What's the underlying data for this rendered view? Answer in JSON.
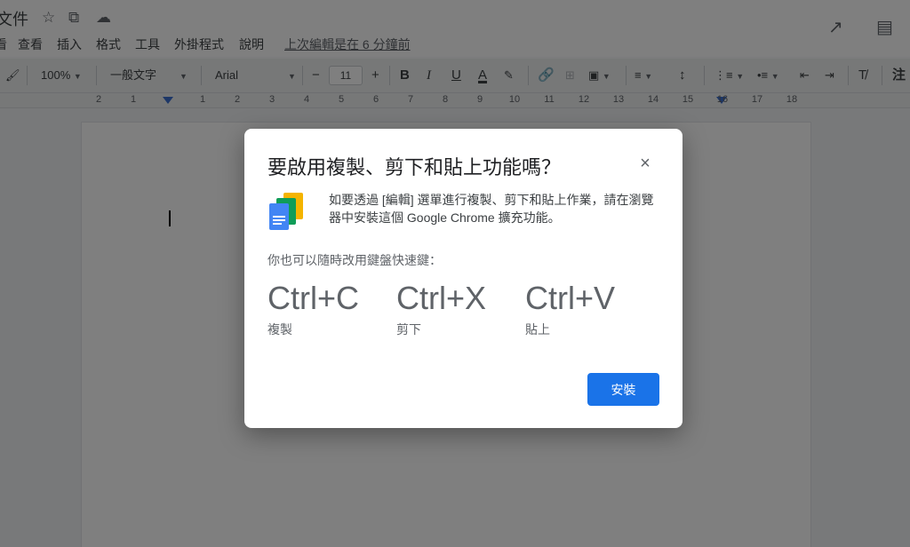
{
  "doc": {
    "title": "文件",
    "last_edit": "上次編輯是在 6 分鐘前"
  },
  "menu": [
    {
      "label": "看"
    },
    {
      "label": "查看"
    },
    {
      "label": "插入"
    },
    {
      "label": "格式"
    },
    {
      "label": "工具"
    },
    {
      "label": "外掛程式"
    },
    {
      "label": "說明"
    }
  ],
  "toolbar": {
    "zoom": "100%",
    "style": "一般文字",
    "font": "Arial",
    "font_size": "11",
    "minus": "−",
    "plus": "+",
    "bold": "B",
    "italic": "I",
    "underline": "U",
    "font_color": "A",
    "clear_formatting": "T̸",
    "extra": "注"
  },
  "ruler": {
    "labels": [
      "2",
      "1",
      "",
      "1",
      "2",
      "3",
      "4",
      "5",
      "6",
      "7",
      "8",
      "9",
      "10",
      "11",
      "12",
      "13",
      "14",
      "15",
      "16",
      "17",
      "18"
    ]
  },
  "dialog": {
    "title": "要啟用複製、剪下和貼上功能嗎？",
    "description": "如要透過 [編輯] 選單進行複製、剪下和貼上作業，請在瀏覽器中安裝這個 Google Chrome 擴充功能。",
    "shortcut_intro": "你也可以隨時改用鍵盤快速鍵：",
    "shortcuts": [
      {
        "key": "Ctrl+C",
        "label": "複製"
      },
      {
        "key": "Ctrl+X",
        "label": "剪下"
      },
      {
        "key": "Ctrl+V",
        "label": "貼上"
      }
    ],
    "install_label": "安裝",
    "close_glyph": "×"
  },
  "colors": {
    "accent": "#1a73e8",
    "docs_blue": "#4285f4",
    "docs_green": "#0f9d58",
    "docs_yellow": "#f4b400"
  }
}
